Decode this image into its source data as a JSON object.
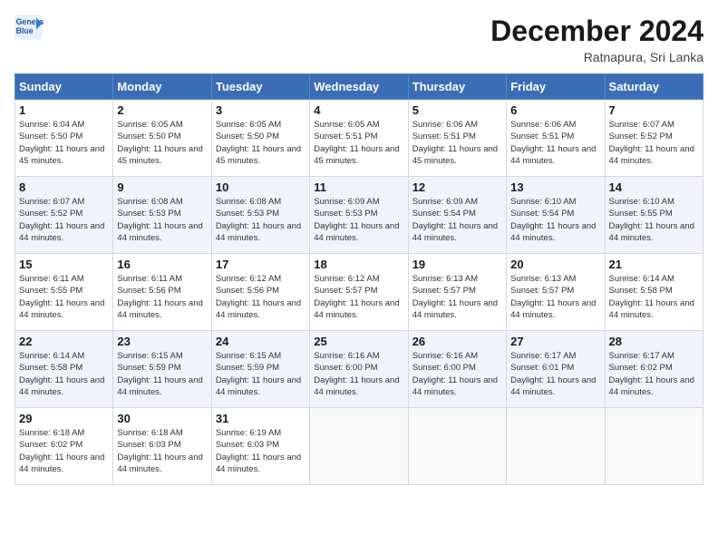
{
  "header": {
    "logo_line1": "General",
    "logo_line2": "Blue",
    "month": "December 2024",
    "location": "Ratnapura, Sri Lanka"
  },
  "weekdays": [
    "Sunday",
    "Monday",
    "Tuesday",
    "Wednesday",
    "Thursday",
    "Friday",
    "Saturday"
  ],
  "weeks": [
    [
      {
        "day": "1",
        "rise": "6:04 AM",
        "set": "5:50 PM",
        "daylight": "11 hours and 45 minutes."
      },
      {
        "day": "2",
        "rise": "6:05 AM",
        "set": "5:50 PM",
        "daylight": "11 hours and 45 minutes."
      },
      {
        "day": "3",
        "rise": "6:05 AM",
        "set": "5:50 PM",
        "daylight": "11 hours and 45 minutes."
      },
      {
        "day": "4",
        "rise": "6:05 AM",
        "set": "5:51 PM",
        "daylight": "11 hours and 45 minutes."
      },
      {
        "day": "5",
        "rise": "6:06 AM",
        "set": "5:51 PM",
        "daylight": "11 hours and 45 minutes."
      },
      {
        "day": "6",
        "rise": "6:06 AM",
        "set": "5:51 PM",
        "daylight": "11 hours and 44 minutes."
      },
      {
        "day": "7",
        "rise": "6:07 AM",
        "set": "5:52 PM",
        "daylight": "11 hours and 44 minutes."
      }
    ],
    [
      {
        "day": "8",
        "rise": "6:07 AM",
        "set": "5:52 PM",
        "daylight": "11 hours and 44 minutes."
      },
      {
        "day": "9",
        "rise": "6:08 AM",
        "set": "5:53 PM",
        "daylight": "11 hours and 44 minutes."
      },
      {
        "day": "10",
        "rise": "6:08 AM",
        "set": "5:53 PM",
        "daylight": "11 hours and 44 minutes."
      },
      {
        "day": "11",
        "rise": "6:09 AM",
        "set": "5:53 PM",
        "daylight": "11 hours and 44 minutes."
      },
      {
        "day": "12",
        "rise": "6:09 AM",
        "set": "5:54 PM",
        "daylight": "11 hours and 44 minutes."
      },
      {
        "day": "13",
        "rise": "6:10 AM",
        "set": "5:54 PM",
        "daylight": "11 hours and 44 minutes."
      },
      {
        "day": "14",
        "rise": "6:10 AM",
        "set": "5:55 PM",
        "daylight": "11 hours and 44 minutes."
      }
    ],
    [
      {
        "day": "15",
        "rise": "6:11 AM",
        "set": "5:55 PM",
        "daylight": "11 hours and 44 minutes."
      },
      {
        "day": "16",
        "rise": "6:11 AM",
        "set": "5:56 PM",
        "daylight": "11 hours and 44 minutes."
      },
      {
        "day": "17",
        "rise": "6:12 AM",
        "set": "5:56 PM",
        "daylight": "11 hours and 44 minutes."
      },
      {
        "day": "18",
        "rise": "6:12 AM",
        "set": "5:57 PM",
        "daylight": "11 hours and 44 minutes."
      },
      {
        "day": "19",
        "rise": "6:13 AM",
        "set": "5:57 PM",
        "daylight": "11 hours and 44 minutes."
      },
      {
        "day": "20",
        "rise": "6:13 AM",
        "set": "5:57 PM",
        "daylight": "11 hours and 44 minutes."
      },
      {
        "day": "21",
        "rise": "6:14 AM",
        "set": "5:58 PM",
        "daylight": "11 hours and 44 minutes."
      }
    ],
    [
      {
        "day": "22",
        "rise": "6:14 AM",
        "set": "5:58 PM",
        "daylight": "11 hours and 44 minutes."
      },
      {
        "day": "23",
        "rise": "6:15 AM",
        "set": "5:59 PM",
        "daylight": "11 hours and 44 minutes."
      },
      {
        "day": "24",
        "rise": "6:15 AM",
        "set": "5:59 PM",
        "daylight": "11 hours and 44 minutes."
      },
      {
        "day": "25",
        "rise": "6:16 AM",
        "set": "6:00 PM",
        "daylight": "11 hours and 44 minutes."
      },
      {
        "day": "26",
        "rise": "6:16 AM",
        "set": "6:00 PM",
        "daylight": "11 hours and 44 minutes."
      },
      {
        "day": "27",
        "rise": "6:17 AM",
        "set": "6:01 PM",
        "daylight": "11 hours and 44 minutes."
      },
      {
        "day": "28",
        "rise": "6:17 AM",
        "set": "6:02 PM",
        "daylight": "11 hours and 44 minutes."
      }
    ],
    [
      {
        "day": "29",
        "rise": "6:18 AM",
        "set": "6:02 PM",
        "daylight": "11 hours and 44 minutes."
      },
      {
        "day": "30",
        "rise": "6:18 AM",
        "set": "6:03 PM",
        "daylight": "11 hours and 44 minutes."
      },
      {
        "day": "31",
        "rise": "6:19 AM",
        "set": "6:03 PM",
        "daylight": "11 hours and 44 minutes."
      },
      null,
      null,
      null,
      null
    ]
  ]
}
